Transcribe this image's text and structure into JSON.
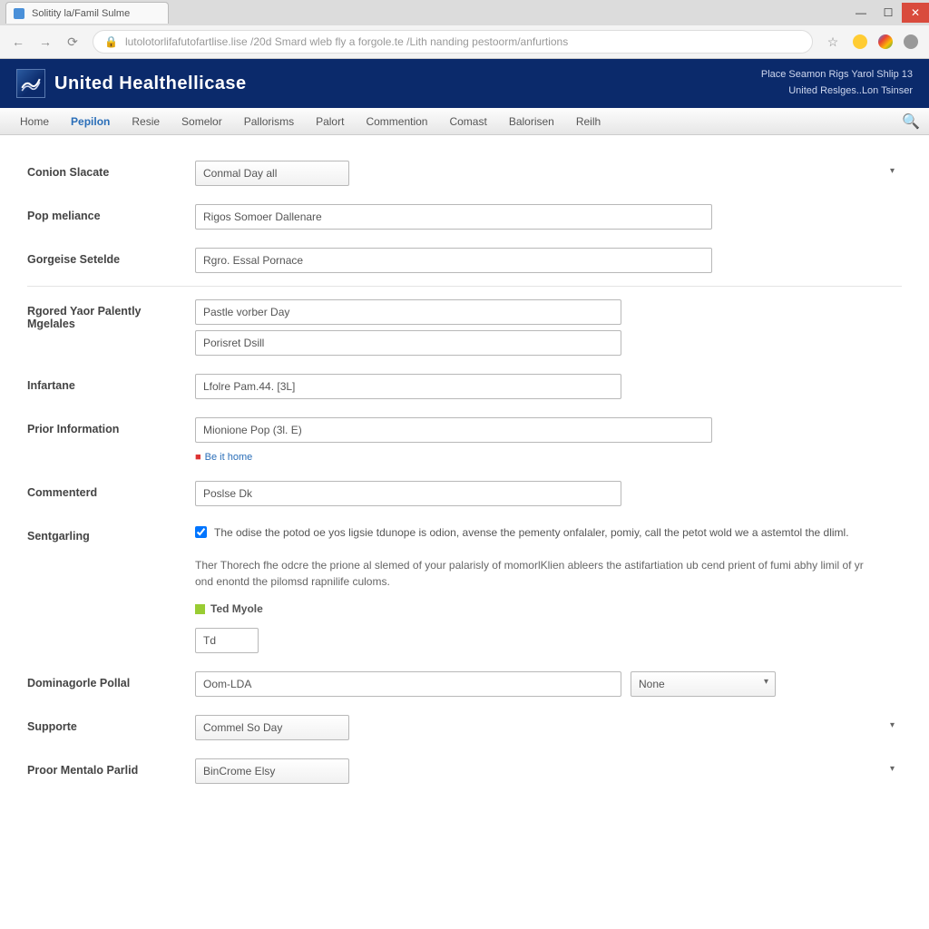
{
  "browser": {
    "tab_title": "Solitity la/Famil Sulme",
    "url": "lutolotorlifafutofartlise.lise  /20d Smard  wleb fly a forgole.te /Lith nanding pestoorm/anfurtions"
  },
  "header": {
    "brand": "United Healthellicase",
    "line1": "Place Seamon Rigs Yarol Shlip 13",
    "line2": "United Reslges..Lon Tsinser"
  },
  "nav": {
    "items": [
      "Home",
      "Pepilon",
      "Resie",
      "Somelor",
      "Pallorisms",
      "Palort",
      "Commention",
      "Comast",
      "Balorisen",
      "Reilh"
    ],
    "active_index": 1
  },
  "form": {
    "f0": {
      "label": "Conion Slacate",
      "value": "Conmal Day all"
    },
    "f1": {
      "label": "Pop meliance",
      "value": "Rigos Somoer Dallenare"
    },
    "f2": {
      "label": "Gorgeise Setelde",
      "value": "Rgro. Essal Pornace"
    },
    "f3": {
      "label": "Rgored Yaor Palently Mgelales",
      "value1": "Pastle vorber Day",
      "value2": "Porisret Dsill"
    },
    "f4": {
      "label": "Infartane",
      "value": "Lfolre Pam.44. [3L]"
    },
    "f5": {
      "label": "Prior Information",
      "value": "Mionione Pop (3l. E)",
      "hint": "Be it home"
    },
    "f6": {
      "label": "Commenterd",
      "value": "Poslse Dk"
    },
    "f7": {
      "label": "Sentgarling",
      "check_text": "The odise the potod oe yos ligsie tdunope is odion, avense the pementy onfalaler, pomiy, call the petot wold we a astemtol the dliml.",
      "note": "Ther Thorech fhe odcre the prione al slemed of your palarisly of momorlKlien ableers the astifartiation ub cend prient of fumi abhy limil of yr ond enontd the pilomsd rapnilife culoms.",
      "badge": "Ted Myole",
      "small_value": "Td"
    },
    "f8": {
      "label": "Dominagorle Pollal",
      "value": "Oom-LDA",
      "sel2": "None"
    },
    "f9": {
      "label": "Supporte",
      "value": "Commel So Day"
    },
    "f10": {
      "label": "Proor Mentalo Parlid",
      "value": "BinCrome Elsy"
    }
  }
}
